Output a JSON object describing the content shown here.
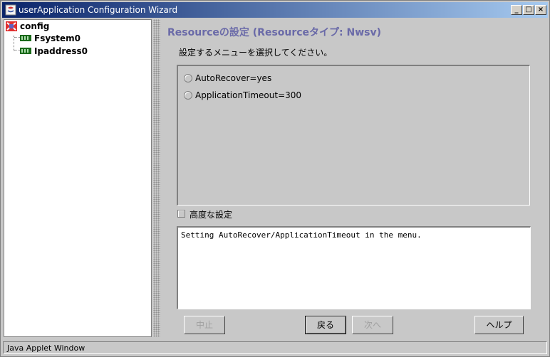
{
  "window": {
    "title": "userApplication Configuration Wizard",
    "controls": {
      "minimize": "_",
      "maximize": "□",
      "close": "×"
    }
  },
  "tree": {
    "items": [
      {
        "label": "config",
        "icon": "config-icon"
      },
      {
        "label": "Fsystem0",
        "icon": "resource-icon"
      },
      {
        "label": "Ipaddress0",
        "icon": "resource-icon"
      }
    ]
  },
  "main": {
    "heading": "Resourceの設定 (Resourceタイプ: Nwsv)",
    "instruction": "設定するメニューを選択してください。",
    "options": [
      {
        "label": "AutoRecover=yes",
        "selected": false
      },
      {
        "label": "ApplicationTimeout=300",
        "selected": false
      }
    ],
    "advanced_label": "高度な設定",
    "advanced_checked": false,
    "message": "Setting AutoRecover/ApplicationTimeout in the menu."
  },
  "buttons": {
    "cancel": "中止",
    "back": "戻る",
    "next": "次へ",
    "help": "ヘルプ"
  },
  "status": {
    "text": "Java Applet Window"
  },
  "colors": {
    "titlebar_start": "#0a246a",
    "titlebar_end": "#a6caf0",
    "heading": "#6a6aa8",
    "background": "#c8c8c8"
  }
}
